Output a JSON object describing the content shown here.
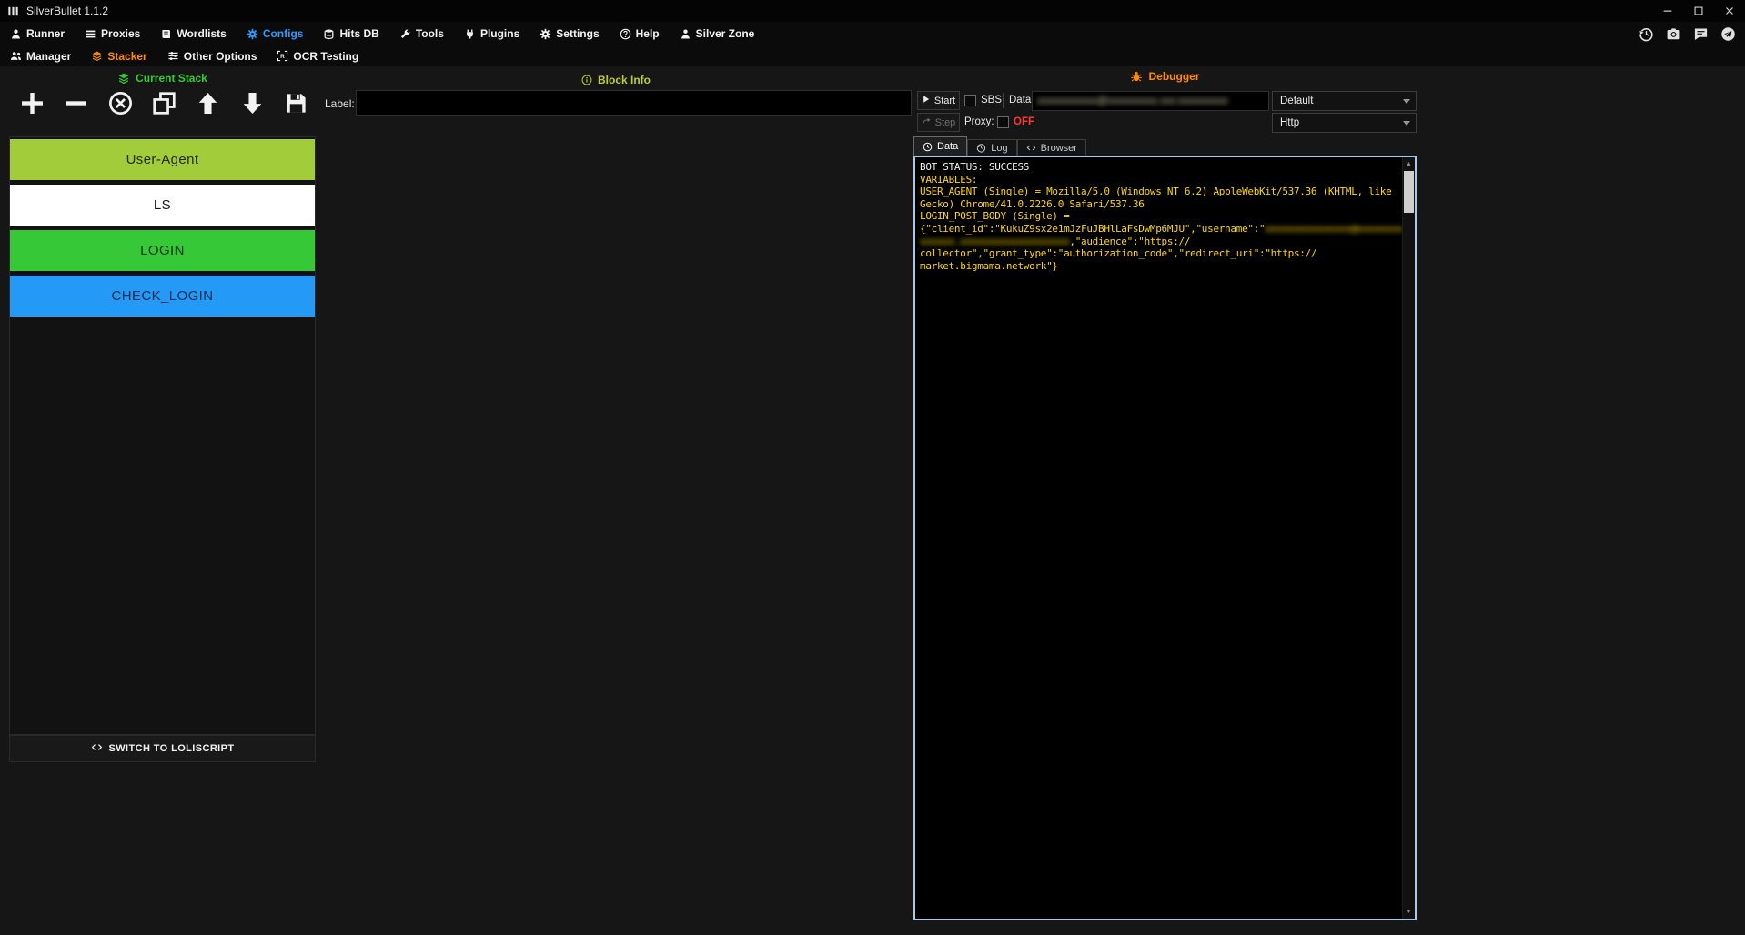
{
  "window": {
    "title": "SilverBullet 1.1.2",
    "controls": [
      {
        "id": "minimize"
      },
      {
        "id": "maximize"
      },
      {
        "id": "close"
      }
    ]
  },
  "menubar": {
    "items": [
      {
        "id": "runner",
        "label": "Runner",
        "icon": "person",
        "color": "#F2F2F2"
      },
      {
        "id": "proxies",
        "label": "Proxies",
        "icon": "bars",
        "color": "#F2F2F2"
      },
      {
        "id": "wordlists",
        "label": "Wordlists",
        "icon": "book",
        "color": "#F2F2F2"
      },
      {
        "id": "configs",
        "label": "Configs",
        "icon": "gear",
        "color": "#2E9BFF",
        "active": true
      },
      {
        "id": "hits-db",
        "label": "Hits DB",
        "icon": "database",
        "color": "#F2F2F2"
      },
      {
        "id": "tools",
        "label": "Tools",
        "icon": "wrench",
        "color": "#F2F2F2"
      },
      {
        "id": "plugins",
        "label": "Plugins",
        "icon": "plug",
        "color": "#F2F2F2"
      },
      {
        "id": "settings",
        "label": "Settings",
        "icon": "gear",
        "color": "#F2F2F2"
      },
      {
        "id": "help",
        "label": "Help",
        "icon": "help",
        "color": "#F2F2F2"
      },
      {
        "id": "silver-zone",
        "label": "Silver Zone",
        "icon": "person",
        "color": "#F2F2F2"
      }
    ],
    "right_icons": [
      {
        "id": "history",
        "icon": "history"
      },
      {
        "id": "screenshot",
        "icon": "camera"
      },
      {
        "id": "chat",
        "icon": "chat"
      },
      {
        "id": "telegram",
        "icon": "telegram"
      }
    ]
  },
  "submenu": {
    "items": [
      {
        "id": "manager",
        "label": "Manager",
        "icon": "people",
        "color": "#F2F2F2"
      },
      {
        "id": "stacker",
        "label": "Stacker",
        "icon": "layers",
        "color": "#FF8C00",
        "active": true
      },
      {
        "id": "other-options",
        "label": "Other Options",
        "icon": "options",
        "color": "#F2F2F2"
      },
      {
        "id": "ocr-testing",
        "label": "OCR Testing",
        "icon": "ocr",
        "color": "#F2F2F2"
      }
    ]
  },
  "stacker": {
    "header": {
      "label": "Current Stack",
      "color": "#32CD32",
      "icon": "layers"
    },
    "toolbar": [
      {
        "id": "add-block",
        "icon": "plus"
      },
      {
        "id": "remove-block",
        "icon": "minus"
      },
      {
        "id": "disable-block",
        "icon": "xcircle"
      },
      {
        "id": "clone-block",
        "icon": "copy"
      },
      {
        "id": "move-block-up",
        "icon": "arrowup"
      },
      {
        "id": "move-block-down",
        "icon": "arrowdown"
      },
      {
        "id": "save-config",
        "icon": "save"
      }
    ],
    "blocks": [
      {
        "label": "User-Agent",
        "bg": "#A3CC3A",
        "fg": "#222a08"
      },
      {
        "label": "LS",
        "bg": "#FFFFFF",
        "fg": "#141414"
      },
      {
        "label": "LOGIN",
        "bg": "#37C837",
        "fg": "#0b3a0b"
      },
      {
        "label": "CHECK_LOGIN",
        "bg": "#2499F5",
        "fg": "#082b50"
      }
    ],
    "switch_button": {
      "label": "SWITCH TO LOLISCRIPT",
      "icon": "code"
    }
  },
  "block_info": {
    "header": {
      "label": "Block Info",
      "color": "#BCCE2A",
      "icon": "info"
    },
    "label_caption": "Label:",
    "label_value": ""
  },
  "debugger": {
    "header": {
      "label": "Debugger",
      "color": "#FF8C00",
      "icon": "bug"
    },
    "start_button": "Start",
    "step_button": "Step",
    "sbs_label": "SBS",
    "data_label": "Data:",
    "data_value_redacted": "xxxxxxxxxxxx@xxxxxxxxxx.xxx:xxxxxxxxxx",
    "wordlist_type": "Default",
    "proxy_label": "Proxy:",
    "proxy_status": "OFF",
    "proxy_status_color": "#FF3B30",
    "proxy_type": "Http",
    "tabs": [
      {
        "id": "data",
        "label": "Data",
        "icon": "clock",
        "active": true
      },
      {
        "id": "log",
        "label": "Log",
        "icon": "history",
        "active": false
      },
      {
        "id": "browser",
        "label": "Browser",
        "icon": "code",
        "active": false
      }
    ],
    "log": {
      "lines": [
        {
          "color": "#F2F2F2",
          "segments": [
            {
              "text": "BOT STATUS: SUCCESS"
            }
          ]
        },
        {
          "color": "#FFD700",
          "segments": [
            {
              "text": "VARIABLES:"
            }
          ]
        },
        {
          "color": "#FFD700",
          "segments": [
            {
              "text": "USER_AGENT (Single) = Mozilla/5.0 (Windows NT 6.2) AppleWebKit/537.36 (KHTML, like"
            }
          ]
        },
        {
          "color": "#FFD700",
          "segments": [
            {
              "text": "Gecko) Chrome/41.0.2226.0 Safari/537.36"
            }
          ]
        },
        {
          "color": "#FFD700",
          "segments": [
            {
              "text": "LOGIN_POST_BODY (Single) ="
            }
          ]
        },
        {
          "color": "#FFD700",
          "segments": [
            {
              "text": "{\"client_id\":\"KukuZ9sx2e1mJzFuJBHlLaFsDwMp6MJU\",\"username\":\""
            },
            {
              "text": "xxxxxxxxxxxxxxx@xxxxxxxx",
              "redacted": true
            }
          ]
        },
        {
          "color": "#FFD700",
          "segments": [
            {
              "text": "xxxxxx.xxxxxxxxxxxxxxxxxxx",
              "redacted": true
            },
            {
              "text": ",\"audience\":\"https://"
            }
          ]
        },
        {
          "color": "#FFD700",
          "segments": [
            {
              "text": "collector\",\"grant_type\":\"authorization_code\",\"redirect_uri\":\"https://"
            }
          ]
        },
        {
          "color": "#FFD700",
          "segments": [
            {
              "text": "market.bigmama.network\"}"
            }
          ]
        }
      ]
    }
  }
}
